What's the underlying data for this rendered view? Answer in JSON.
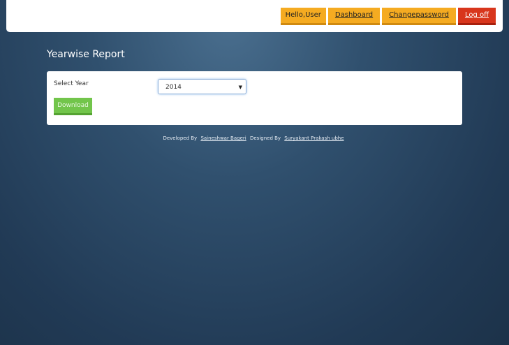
{
  "nav": {
    "hello": "Hello,User",
    "dashboard": "Dashboard",
    "change_password": "Changepassword",
    "logoff": "Log off"
  },
  "page_title": "Yearwise Report",
  "form": {
    "year_label": "Select Year",
    "year_value": "2014",
    "download": "Download"
  },
  "footer": {
    "developed_by": "Developed By",
    "developer": "Saineshwar Bageri",
    "designed_by": "Designed By",
    "designer": "Suryakant Prakash ubhe"
  }
}
